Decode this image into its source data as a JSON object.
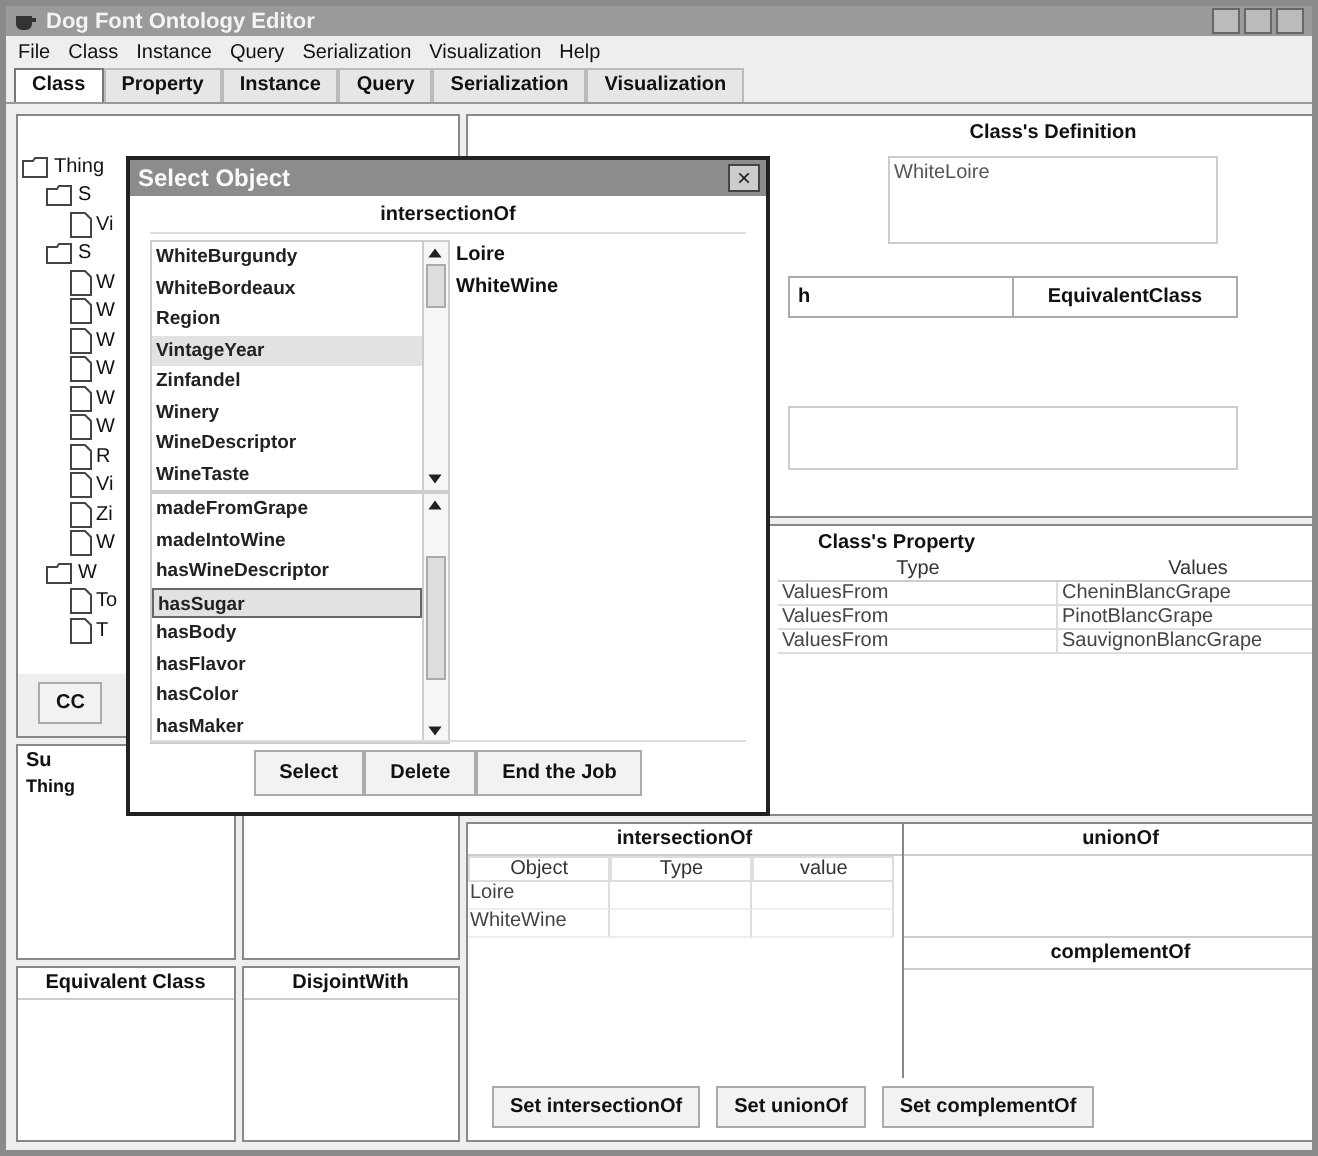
{
  "window": {
    "title": "Dog Font Ontology Editor"
  },
  "menu": [
    "File",
    "Class",
    "Instance",
    "Query",
    "Serialization",
    "Visualization",
    "Help"
  ],
  "tabs": [
    {
      "label": "Class",
      "selected": true
    },
    {
      "label": "Property",
      "selected": false
    },
    {
      "label": "Instance",
      "selected": false
    },
    {
      "label": "Query",
      "selected": false
    },
    {
      "label": "Serialization",
      "selected": false
    },
    {
      "label": "Visualization",
      "selected": false
    }
  ],
  "class_hierarchy": {
    "tree": [
      {
        "label": "Thing",
        "kind": "folder",
        "children": [
          {
            "label": "S",
            "kind": "folder",
            "children": [
              {
                "label": "Vi",
                "kind": "leaf"
              }
            ]
          },
          {
            "label": "S",
            "kind": "folder",
            "children": [
              {
                "label": "W",
                "kind": "leaf"
              },
              {
                "label": "W",
                "kind": "leaf"
              },
              {
                "label": "W",
                "kind": "leaf"
              },
              {
                "label": "W",
                "kind": "leaf"
              },
              {
                "label": "W",
                "kind": "leaf"
              },
              {
                "label": "W",
                "kind": "leaf"
              },
              {
                "label": "R",
                "kind": "leaf"
              },
              {
                "label": "Vi",
                "kind": "leaf"
              },
              {
                "label": "Zi",
                "kind": "leaf"
              },
              {
                "label": "W",
                "kind": "leaf"
              }
            ]
          },
          {
            "label": "W",
            "kind": "folder",
            "children": [
              {
                "label": "To",
                "kind": "leaf"
              },
              {
                "label": "T",
                "kind": "leaf"
              }
            ]
          }
        ]
      }
    ],
    "button": "CC"
  },
  "superclass": {
    "header": "Su",
    "items": [
      "Thing"
    ]
  },
  "equivalent_class": {
    "header": "Equivalent Class"
  },
  "disjoint_with": {
    "header": "DisjointWith"
  },
  "definition": {
    "title": "Class's Definition",
    "text": "WhiteLoire",
    "headers": [
      "h",
      "EquivalentClass"
    ]
  },
  "property": {
    "title": "Class's Property",
    "columns": [
      "Type",
      "Values"
    ],
    "rows": [
      {
        "type": "ValuesFrom",
        "value": "CheninBlancGrape"
      },
      {
        "type": "ValuesFrom",
        "value": "PinotBlancGrape"
      },
      {
        "type": "ValuesFrom",
        "value": "SauvignonBlancGrape"
      }
    ]
  },
  "intersection": {
    "title": "intersectionOf",
    "columns": [
      "Object",
      "Type",
      "value"
    ],
    "rows": [
      "Loire",
      "WhiteWine"
    ]
  },
  "union": {
    "title": "unionOf"
  },
  "complement": {
    "title": "complementOf"
  },
  "buttons": [
    "Set intersectionOf",
    "Set unionOf",
    "Set complementOf"
  ],
  "dialog": {
    "title": "Select Object",
    "close": "×",
    "header": "intersectionOf",
    "classes": [
      {
        "label": "WhiteBurgundy",
        "selected": false
      },
      {
        "label": "WhiteBordeaux",
        "selected": false
      },
      {
        "label": "Region",
        "selected": false
      },
      {
        "label": "VintageYear",
        "selected": true
      },
      {
        "label": "Zinfandel",
        "selected": false
      },
      {
        "label": "Winery",
        "selected": false
      },
      {
        "label": "WineDescriptor",
        "selected": false
      },
      {
        "label": "WineTaste",
        "selected": false
      }
    ],
    "properties": [
      {
        "label": "madeFromGrape",
        "selected": false
      },
      {
        "label": "madeIntoWine",
        "selected": false
      },
      {
        "label": "hasWineDescriptor",
        "selected": false
      },
      {
        "label": "hasSugar",
        "selected": true
      },
      {
        "label": "hasBody",
        "selected": false
      },
      {
        "label": "hasFlavor",
        "selected": false
      },
      {
        "label": "hasColor",
        "selected": false
      },
      {
        "label": "hasMaker",
        "selected": false
      }
    ],
    "chosen": [
      "Loire",
      "WhiteWine"
    ],
    "buttons": [
      "Select",
      "Delete",
      "End the Job"
    ]
  }
}
